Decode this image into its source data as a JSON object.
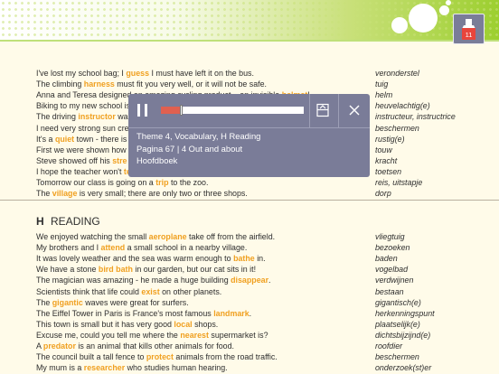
{
  "colors": {
    "highlight": "#f0a020",
    "player_bg": "#7a7c98",
    "progress": "#e06050",
    "header_green": "#9ccf2f"
  },
  "app_button": {
    "icon": "book-icon",
    "badge": "11"
  },
  "vocab_top": [
    {
      "parts": [
        [
          "I've lost my school bag; I ",
          0
        ],
        [
          "guess",
          1
        ],
        [
          " I must have left it on the bus.",
          0
        ]
      ],
      "nl": "veronderstel"
    },
    {
      "parts": [
        [
          "The climbing ",
          0
        ],
        [
          "harness",
          1
        ],
        [
          " must fit you very well, or it will not be safe.",
          0
        ]
      ],
      "nl": "tuig"
    },
    {
      "parts": [
        [
          "Anna and Teresa designed an amazing cycling product – an invisible ",
          0
        ],
        [
          "helmet",
          1
        ],
        [
          "!",
          0
        ]
      ],
      "nl": "helm"
    },
    {
      "parts": [
        [
          "Biking to my new school is",
          0
        ]
      ],
      "nl": "heuvelachtig(e)"
    },
    {
      "parts": [
        [
          "The driving ",
          0
        ],
        [
          "instructor",
          1
        ],
        [
          " was",
          0
        ]
      ],
      "nl": "instructeur, instructrice"
    },
    {
      "parts": [
        [
          "I need very strong sun cre",
          0
        ]
      ],
      "nl": "beschermen"
    },
    {
      "parts": [
        [
          "It's a ",
          0
        ],
        [
          "quiet",
          1
        ],
        [
          " town - there is",
          0
        ]
      ],
      "nl": "rustig(e)"
    },
    {
      "parts": [
        [
          "First we were shown how",
          0
        ]
      ],
      "nl": "touw"
    },
    {
      "parts": [
        [
          "Steve showed off his ",
          0
        ],
        [
          "stre",
          1
        ]
      ],
      "nl": "kracht"
    },
    {
      "parts": [
        [
          "I hope the teacher won't ",
          0
        ],
        [
          "test",
          1
        ],
        [
          " us today, because I've forgotten everything!",
          0
        ]
      ],
      "nl": "toetsen"
    },
    {
      "parts": [
        [
          "Tomorrow our class is going on a ",
          0
        ],
        [
          "trip",
          1
        ],
        [
          " to the zoo.",
          0
        ]
      ],
      "nl": "reis, uitstapje"
    },
    {
      "parts": [
        [
          "The ",
          0
        ],
        [
          "village",
          1
        ],
        [
          " is very small; there are only two or three shops.",
          0
        ]
      ],
      "nl": "dorp"
    }
  ],
  "section": {
    "letter": "H",
    "title": "READING"
  },
  "vocab_reading": [
    {
      "parts": [
        [
          "We enjoyed watching the small ",
          0
        ],
        [
          "aeroplane",
          1
        ],
        [
          " take off from the airfield.",
          0
        ]
      ],
      "nl": "vliegtuig"
    },
    {
      "parts": [
        [
          "My brothers and I ",
          0
        ],
        [
          "attend",
          1
        ],
        [
          " a small school in a nearby village.",
          0
        ]
      ],
      "nl": "bezoeken"
    },
    {
      "parts": [
        [
          "It was lovely weather and the sea was warm enough to ",
          0
        ],
        [
          "bathe",
          1
        ],
        [
          " in.",
          0
        ]
      ],
      "nl": "baden"
    },
    {
      "parts": [
        [
          "We have a stone ",
          0
        ],
        [
          "bird bath",
          1
        ],
        [
          " in our garden, but our cat sits in it!",
          0
        ]
      ],
      "nl": "vogelbad"
    },
    {
      "parts": [
        [
          "The magician was amazing - he made a huge building ",
          0
        ],
        [
          "disappear",
          1
        ],
        [
          ".",
          0
        ]
      ],
      "nl": "verdwijnen"
    },
    {
      "parts": [
        [
          "Scientists think that life could ",
          0
        ],
        [
          "exist",
          1
        ],
        [
          " on other planets.",
          0
        ]
      ],
      "nl": "bestaan"
    },
    {
      "parts": [
        [
          "The ",
          0
        ],
        [
          "gigantic",
          1
        ],
        [
          " waves were great for surfers.",
          0
        ]
      ],
      "nl": "gigantisch(e)"
    },
    {
      "parts": [
        [
          "The Eiffel Tower in Paris is France's most famous ",
          0
        ],
        [
          "landmark",
          1
        ],
        [
          ".",
          0
        ]
      ],
      "nl": "herkenningspunt"
    },
    {
      "parts": [
        [
          "This town is small but it has very good ",
          0
        ],
        [
          "local",
          1
        ],
        [
          " shops.",
          0
        ]
      ],
      "nl": "plaatselijk(e)"
    },
    {
      "parts": [
        [
          "Excuse me, could you tell me where the ",
          0
        ],
        [
          "nearest",
          1
        ],
        [
          " supermarket is?",
          0
        ]
      ],
      "nl": "dichtsbijzijnd(e)"
    },
    {
      "parts": [
        [
          "A ",
          0
        ],
        [
          "predator",
          1
        ],
        [
          " is an animal that kills other animals for food.",
          0
        ]
      ],
      "nl": "roofdier"
    },
    {
      "parts": [
        [
          "The council built a tall fence to ",
          0
        ],
        [
          "protect",
          1
        ],
        [
          " animals from the road traffic.",
          0
        ]
      ],
      "nl": "beschermen"
    },
    {
      "parts": [
        [
          "My mum is a ",
          0
        ],
        [
          "researcher",
          1
        ],
        [
          " who studies human hearing.",
          0
        ]
      ],
      "nl": "onderzoek(st)er"
    }
  ],
  "player": {
    "progress": 0.14,
    "line1": "Theme 4, Vocabulary, H Reading",
    "line2": "Pagina 67 | 4 Out and about",
    "line3": "Hoofdboek"
  }
}
